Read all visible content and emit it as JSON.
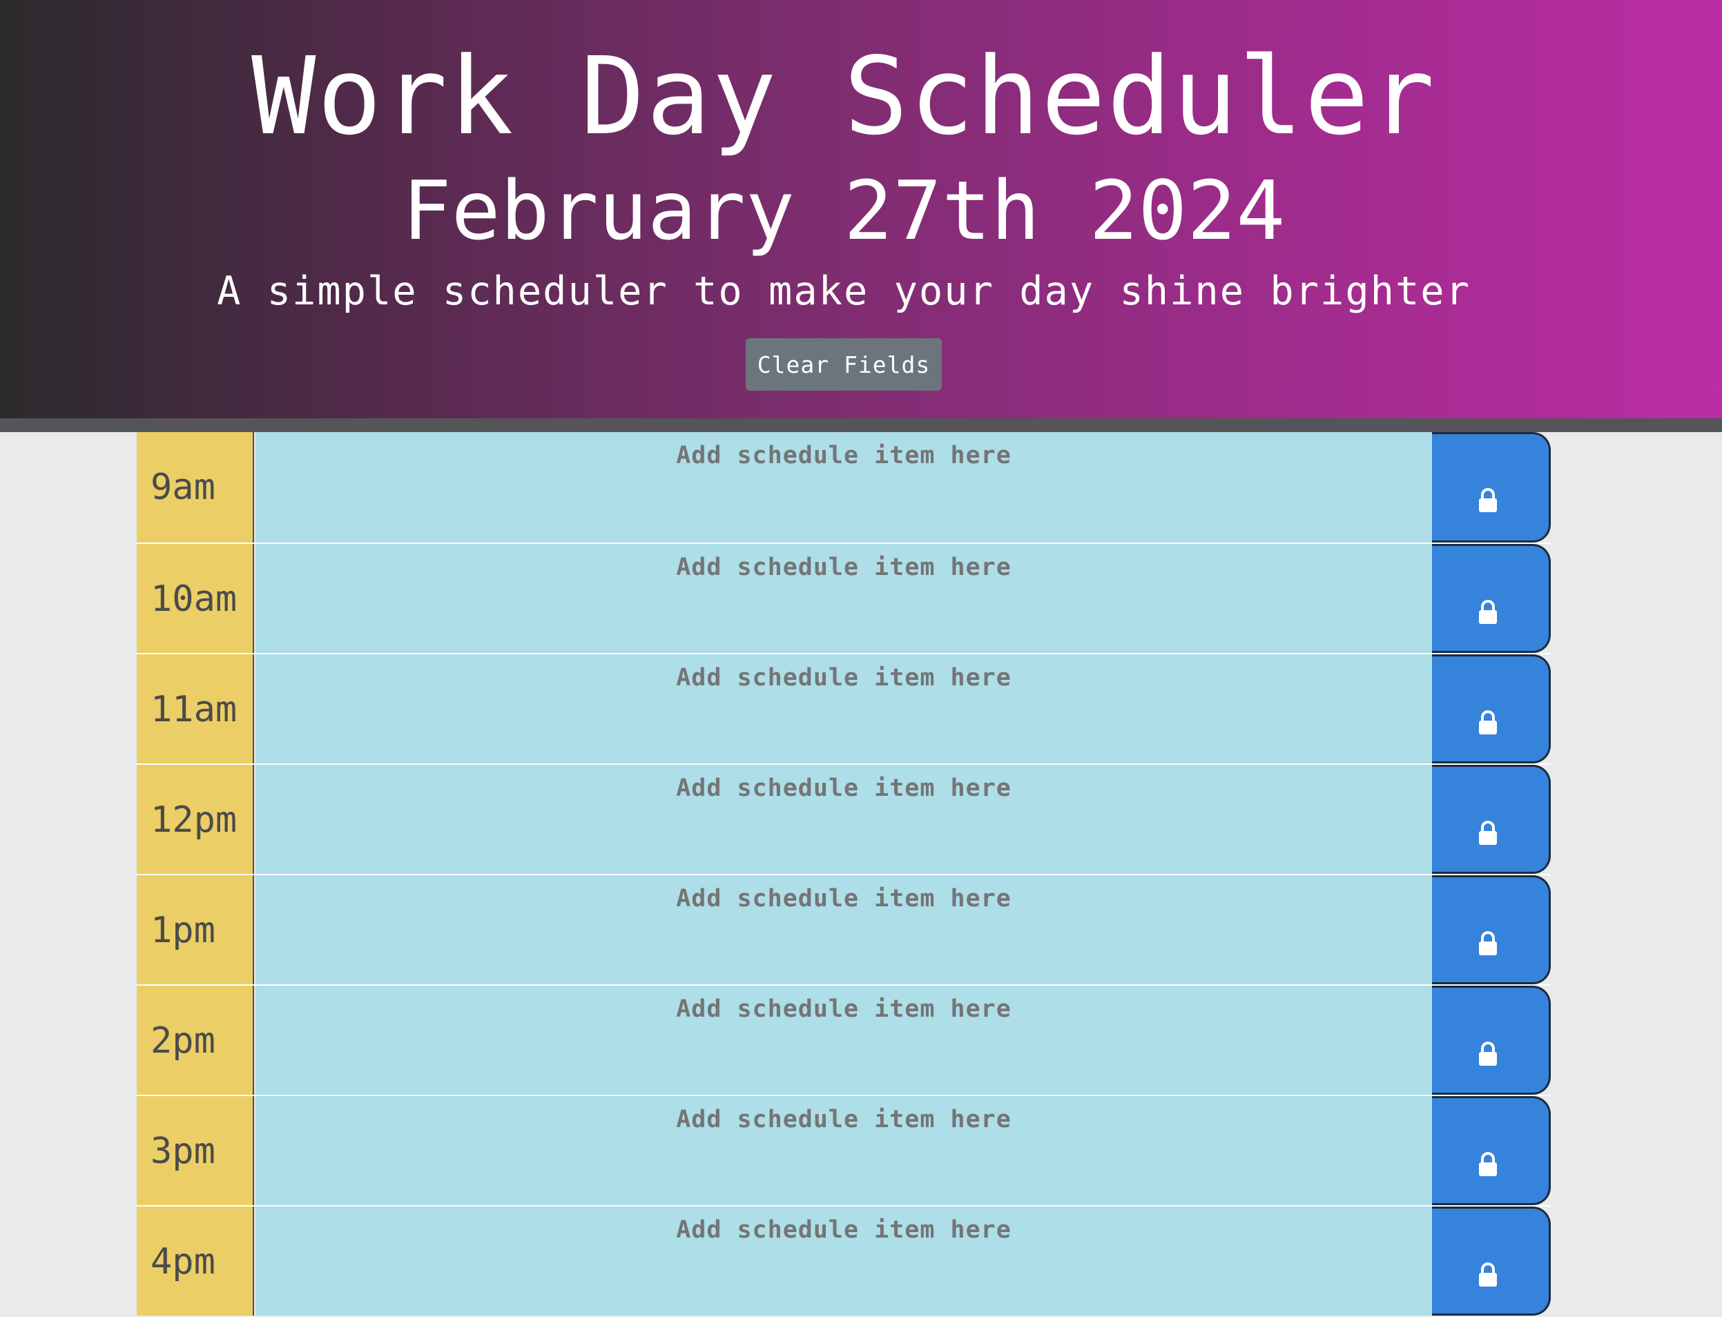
{
  "header": {
    "title": "Work Day Scheduler",
    "date": "February 27th 2024",
    "tagline": "A simple scheduler to make your day shine brighter",
    "clear_label": "Clear Fields"
  },
  "schedule": {
    "placeholder": "Add schedule item here",
    "save_icon": "lock-icon",
    "rows": [
      {
        "hour": "9am",
        "value": ""
      },
      {
        "hour": "10am",
        "value": ""
      },
      {
        "hour": "11am",
        "value": ""
      },
      {
        "hour": "12pm",
        "value": ""
      },
      {
        "hour": "1pm",
        "value": ""
      },
      {
        "hour": "2pm",
        "value": ""
      },
      {
        "hour": "3pm",
        "value": ""
      },
      {
        "hour": "4pm",
        "value": ""
      }
    ]
  },
  "colors": {
    "hour_block": "#ecce66",
    "future": "#aedee8",
    "save_button": "#3583db",
    "clear_button": "#6c757d"
  }
}
